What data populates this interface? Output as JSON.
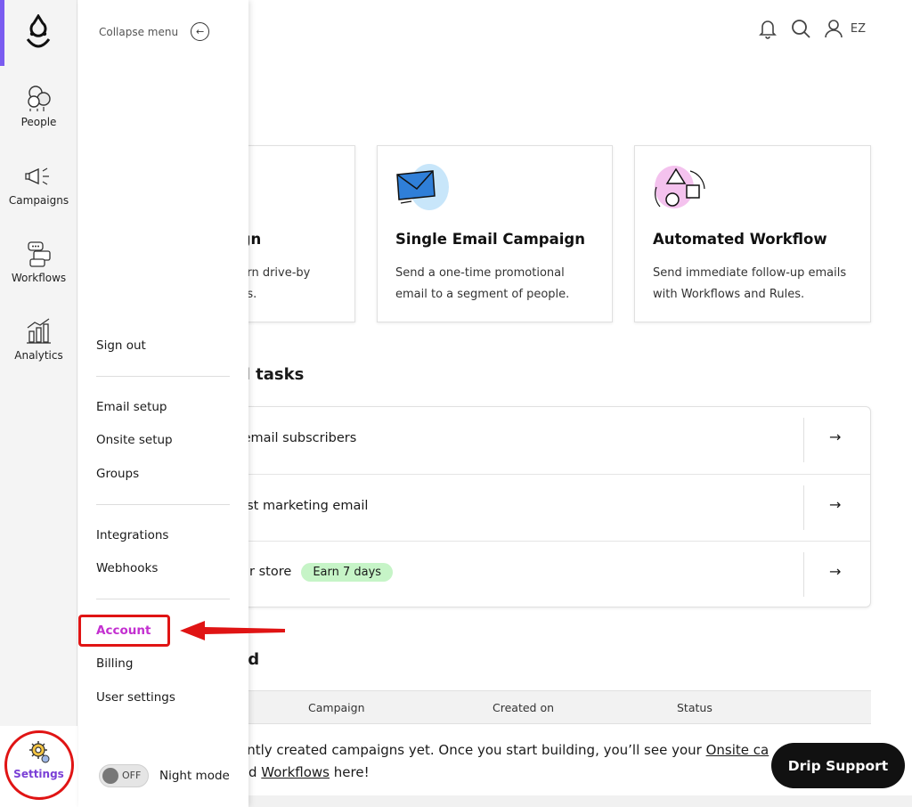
{
  "rail": {
    "items": [
      {
        "label": "People"
      },
      {
        "label": "Campaigns"
      },
      {
        "label": "Workflows"
      },
      {
        "label": "Analytics"
      }
    ],
    "settings_label": "Settings",
    "accent_color": "#7a5cf0"
  },
  "menu": {
    "collapse_label": "Collapse menu",
    "sign_out": "Sign out",
    "email_setup": "Email setup",
    "onsite_setup": "Onsite setup",
    "groups": "Groups",
    "integrations": "Integrations",
    "webhooks": "Webhooks",
    "account": "Account",
    "billing": "Billing",
    "user_settings": "User settings",
    "toggle_state": "OFF",
    "night_mode": "Night mode",
    "account_color": "#c32fd0"
  },
  "header": {
    "initials": "EZ"
  },
  "main": {
    "heading_1": ".",
    "cards": [
      {
        "title": "ign",
        "desc_1": "turn drive-by",
        "desc_2": "ers."
      },
      {
        "title": "Single Email Campaign",
        "desc_1": "Send a one-time promotional",
        "desc_2": "email to a segment of people."
      },
      {
        "title": "Automated Workflow",
        "desc_1": "Send immediate follow-up emails",
        "desc_2": "with Workflows and Rules."
      }
    ],
    "heading_2": "d tasks",
    "tasks": [
      {
        "text": "r email subscribers",
        "arrow": "→"
      },
      {
        "text": "first marketing email",
        "arrow": "→"
      },
      {
        "text": "our store",
        "badge": "Earn 7 days",
        "arrow": "→"
      }
    ],
    "heading_3": "ed",
    "table_headers": [
      "Campaign",
      "Created on",
      "Status"
    ],
    "empty_line_1_pre": "ently created campaigns yet. Once you start building, you’ll see your ",
    "empty_line_1_link": "Onsite ca",
    "empty_line_2_pre": "d ",
    "empty_line_2_link": "Workflows",
    "empty_line_2_post": " here!"
  },
  "support": {
    "label": "Drip Support"
  }
}
